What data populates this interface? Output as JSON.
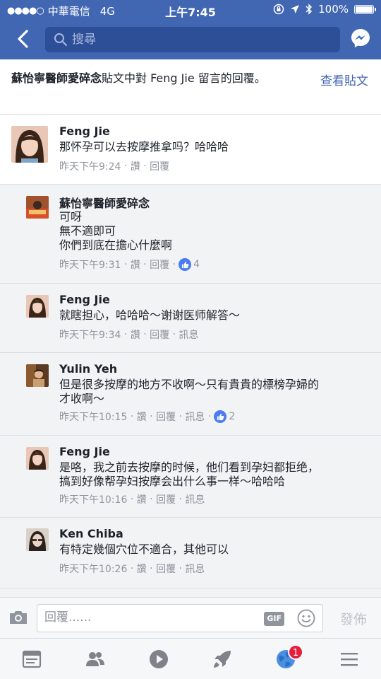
{
  "status_bar": {
    "signal": "●●●●○",
    "carrier": "中華電信",
    "network": "4G",
    "time": "上午7:45",
    "battery": "100%",
    "battery_level": 1.0
  },
  "nav": {
    "search_placeholder": "搜尋"
  },
  "post_header": {
    "page_name": "蘇怡寧醫師愛碎念",
    "description_mid": "貼文中對 Feng Jie 留言的回覆。",
    "view_post": "查看貼文"
  },
  "comments": [
    {
      "name": "Feng Jie",
      "text": "那怀孕可以去按摩推拿吗？哈哈哈",
      "time": "昨天下午9:24",
      "actions": [
        "讚",
        "回覆"
      ],
      "likes": ""
    },
    {
      "name": "蘇怡寧醫師愛碎念",
      "text": "可呀\n無不適即可\n你們到底在擔心什麼啊",
      "time": "昨天下午9:31",
      "actions": [
        "讚",
        "回覆"
      ],
      "likes": "4"
    },
    {
      "name": "Feng Jie",
      "text": "就瞎担心，哈哈哈～谢谢医师解答～",
      "time": "昨天下午9:34",
      "actions": [
        "讚",
        "回覆",
        "訊息"
      ],
      "likes": ""
    },
    {
      "name": "Yulin Yeh",
      "text": "但是很多按摩的地方不收啊～只有貴貴的標榜孕婦的\n才收啊～",
      "time": "昨天下午10:15",
      "actions": [
        "讚",
        "回覆",
        "訊息"
      ],
      "likes": "2"
    },
    {
      "name": "Feng Jie",
      "text": "是咯，我之前去按摩的时候，他们看到孕妇都拒绝，\n搞到好像帮孕妇按摩会出什么事一样～哈哈哈",
      "time": "昨天下午10:16",
      "actions": [
        "讚",
        "回覆",
        "訊息"
      ],
      "likes": ""
    },
    {
      "name": "Ken Chiba",
      "text": "有特定幾個穴位不適合，其他可以",
      "time": "昨天下午10:26",
      "actions": [
        "讚",
        "回覆",
        "訊息"
      ],
      "likes": ""
    }
  ],
  "reply_bar": {
    "placeholder": "回覆......",
    "gif_label": "GIF",
    "post_label": "發佈"
  },
  "tab_bar": {
    "tabs": [
      "news-feed-icon",
      "friends-icon",
      "video-icon",
      "explore-icon",
      "notifications-icon",
      "menu-icon"
    ],
    "notification_count": "1"
  },
  "colors": {
    "brand": "#4267b2",
    "link": "#4267b2",
    "meta": "#90949c",
    "like": "#4a7cf3",
    "badge": "#e41e3f"
  }
}
